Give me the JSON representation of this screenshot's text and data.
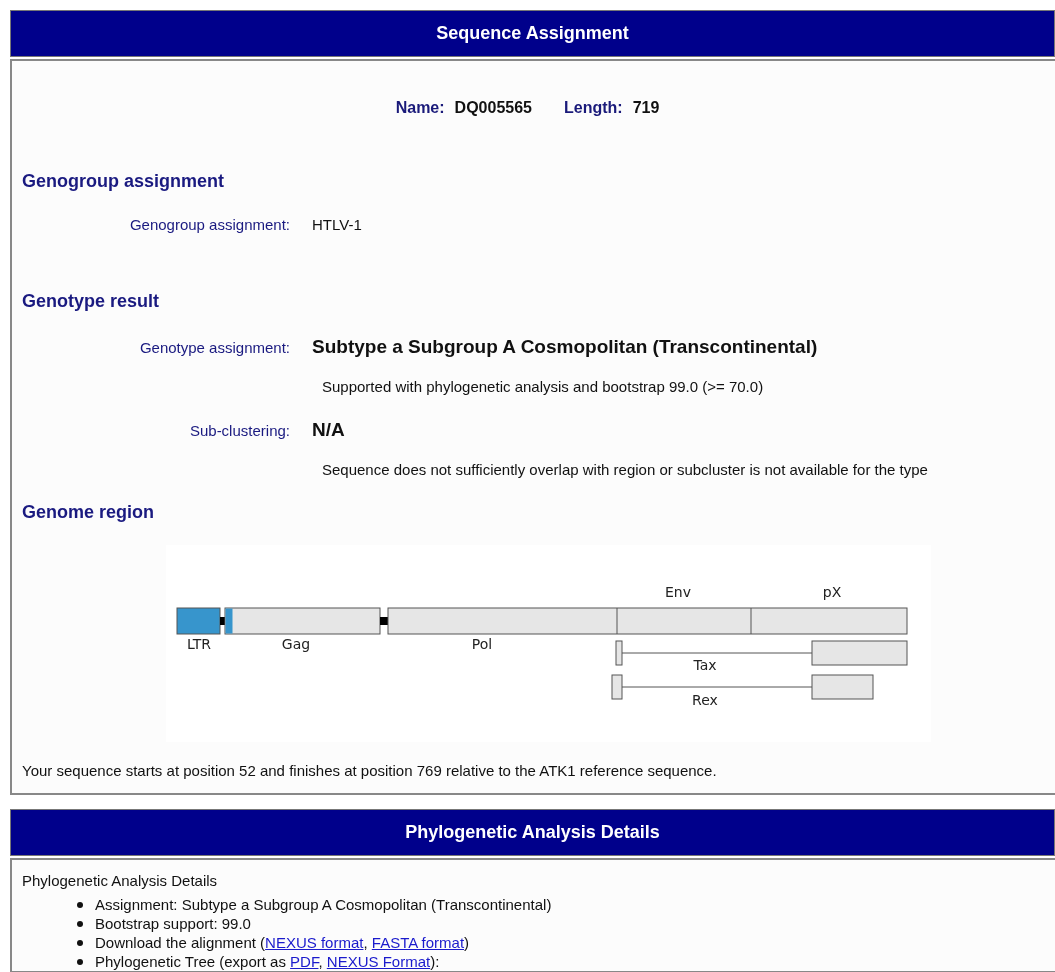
{
  "assignment_panel": {
    "title": "Sequence Assignment",
    "summary": [
      {
        "label": "Name:",
        "value": "DQ005565"
      },
      {
        "label": "Length:",
        "value": "719"
      }
    ],
    "sections": [
      {
        "heading": "Genogroup assignment",
        "fields": [
          {
            "label": "Genogroup assignment:",
            "value": "HTLV-1",
            "emphasis": false
          }
        ]
      },
      {
        "heading": "Genotype result",
        "fields": [
          {
            "label": "Genotype assignment:",
            "value": "Subtype a Subgroup A Cosmopolitan (Transcontinental)",
            "emphasis": true,
            "note": "Supported with phylogenetic analysis and bootstrap 99.0 (>= 70.0)"
          },
          {
            "label": "Sub-clustering:",
            "value": "N/A",
            "emphasis": true,
            "note": "Sequence does not sufficiently overlap with region or subcluster is not available for the type"
          }
        ]
      }
    ],
    "genome_region": {
      "heading": "Genome region",
      "labels": [
        "LTR",
        "Gag",
        "Pol",
        "Env",
        "pX",
        "Tax",
        "Rex"
      ],
      "position_text": "Your sequence starts at position 52 and finishes at position 769 relative to the ATK1 reference sequence."
    }
  },
  "phylo_panel": {
    "title": "Phylogenetic Analysis Details",
    "intro": "Phylogenetic Analysis Details",
    "items": [
      [
        {
          "text": "Assignment: Subtype a Subgroup A Cosmopolitan (Transcontinental)"
        }
      ],
      [
        {
          "text": "Bootstrap support: 99.0"
        }
      ],
      [
        {
          "text": "Download the alignment ("
        },
        {
          "link": "NEXUS format"
        },
        {
          "text": ", "
        },
        {
          "link": "FASTA format"
        },
        {
          "text": ")"
        }
      ],
      [
        {
          "text": "Phylogenetic Tree (export as "
        },
        {
          "link": "PDF"
        },
        {
          "text": ", "
        },
        {
          "link": "NEXUS Format"
        },
        {
          "text": "):"
        }
      ]
    ]
  }
}
